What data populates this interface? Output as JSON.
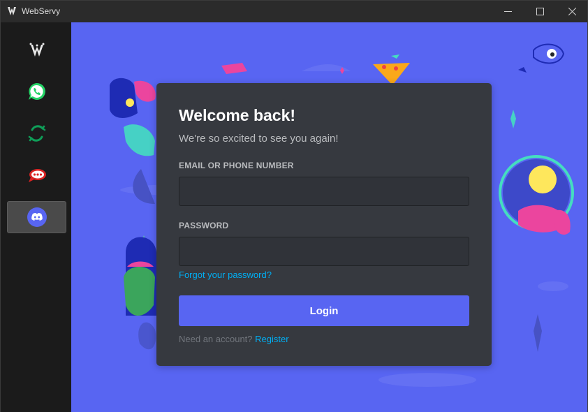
{
  "window": {
    "title": "WebServy",
    "controls": [
      "minimize-icon",
      "maximize-icon",
      "close-icon"
    ]
  },
  "sidebar": {
    "items": [
      {
        "name": "webservy",
        "icon": "webservy-logo-icon",
        "active": false
      },
      {
        "name": "whatsapp",
        "icon": "whatsapp-icon",
        "active": false
      },
      {
        "name": "hangouts",
        "icon": "hangouts-icon",
        "active": false
      },
      {
        "name": "rocketchat",
        "icon": "rocketchat-icon",
        "active": false
      },
      {
        "name": "discord",
        "icon": "discord-icon",
        "active": true
      }
    ]
  },
  "login": {
    "heading": "Welcome back!",
    "subtitle": "We're so excited to see you again!",
    "email_label": "EMAIL OR PHONE NUMBER",
    "email_value": "",
    "password_label": "PASSWORD",
    "password_value": "",
    "forgot": "Forgot your password?",
    "login_button": "Login",
    "need_account": "Need an account?",
    "register": "Register"
  },
  "colors": {
    "background": "#5865f2",
    "card": "#36393f",
    "input": "#303339",
    "link": "#00aff4",
    "button": "#5865f2"
  }
}
